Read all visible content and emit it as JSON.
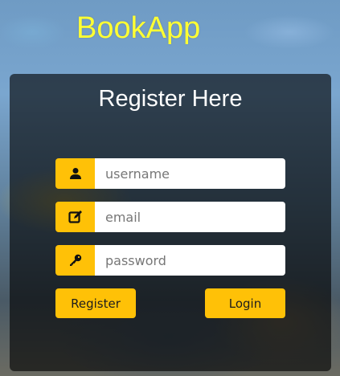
{
  "brand": {
    "name": "BookApp",
    "color": "#ffff33"
  },
  "form": {
    "title": "Register Here",
    "fields": {
      "username": {
        "placeholder": "username",
        "value": "",
        "icon": "user-icon"
      },
      "email": {
        "placeholder": "email",
        "value": "",
        "icon": "edit-icon"
      },
      "password": {
        "placeholder": "password",
        "value": "",
        "icon": "key-icon"
      }
    },
    "buttons": {
      "register_label": "Register",
      "login_label": "Login"
    }
  },
  "colors": {
    "accent": "#ffc107",
    "panel": "rgba(0,0,0,0.62)",
    "title_text": "#ffffff"
  }
}
